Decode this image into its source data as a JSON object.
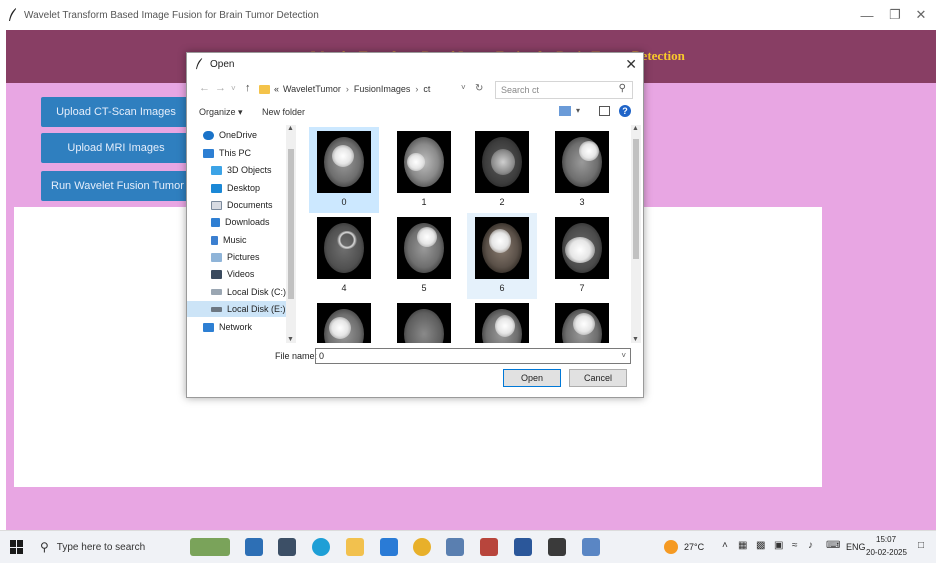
{
  "window": {
    "title": "Wavelet Transform Based Image Fusion for Brain Tumor Detection",
    "minimize_icon": "minimize-icon",
    "maximize_icon": "restore-icon",
    "close_icon": "close-icon"
  },
  "app": {
    "heading_visible": "Detection",
    "buttons": {
      "upload_ct": "Upload CT-Scan Images",
      "upload_mri": "Upload MRI Images",
      "run_fusion": "Run Wavelet Fusion Tumor Detection"
    },
    "colors": {
      "background": "#e8a6e3",
      "header": "#883e64",
      "heading_text": "#f8c92b",
      "button": "#2f7fbf"
    }
  },
  "dialog": {
    "title": "Open",
    "breadcrumb_prefix": "«",
    "breadcrumb": [
      "WaveletTumor",
      "FusionImages",
      "ct"
    ],
    "search_placeholder": "Search ct",
    "organize": "Organize ▾",
    "new_folder": "New folder",
    "nav_items": [
      {
        "label": "OneDrive",
        "icon": "cloud-icon"
      },
      {
        "label": "This PC",
        "icon": "computer-icon"
      },
      {
        "label": "3D Objects",
        "icon": "cube-icon"
      },
      {
        "label": "Desktop",
        "icon": "desktop-icon"
      },
      {
        "label": "Documents",
        "icon": "document-icon"
      },
      {
        "label": "Downloads",
        "icon": "download-icon"
      },
      {
        "label": "Music",
        "icon": "music-icon"
      },
      {
        "label": "Pictures",
        "icon": "picture-icon"
      },
      {
        "label": "Videos",
        "icon": "video-icon"
      },
      {
        "label": "Local Disk (C:)",
        "icon": "drive-icon"
      },
      {
        "label": "Local Disk (E:)",
        "icon": "drive-icon"
      },
      {
        "label": "Network",
        "icon": "network-icon"
      }
    ],
    "files": [
      "0",
      "1",
      "2",
      "3",
      "4",
      "5",
      "6",
      "7",
      "",
      "",
      "",
      ""
    ],
    "selected_file": "0",
    "file_name_label": "File name:",
    "file_name_value": "0",
    "open_button": "Open",
    "cancel_button": "Cancel"
  },
  "taskbar": {
    "search_placeholder": "Type here to search",
    "temperature": "27°C",
    "language": "ENG",
    "time": "15:07",
    "date": "20-02-2025"
  }
}
